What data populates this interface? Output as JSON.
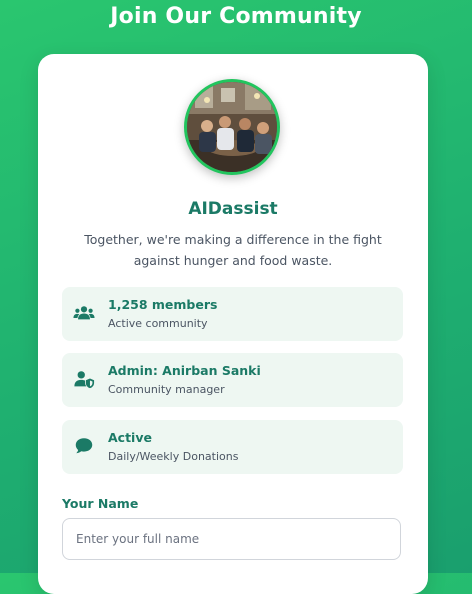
{
  "page": {
    "title": "Join Our Community"
  },
  "community": {
    "name": "AIDassist",
    "description": "Together, we're making a difference in the fight against hunger and food waste."
  },
  "info_items": [
    {
      "title": "1,258 members",
      "subtitle": "Active community",
      "icon": "users-icon"
    },
    {
      "title": "Admin: Anirban Sanki",
      "subtitle": "Community manager",
      "icon": "user-shield-icon"
    },
    {
      "title": "Active",
      "subtitle": "Daily/Weekly Donations",
      "icon": "comment-icon"
    }
  ],
  "form": {
    "name_label": "Your Name",
    "name_value": "",
    "name_placeholder": "Enter your full name"
  },
  "colors": {
    "background_gradient_start": "#2ac66f",
    "background_gradient_end": "#1a9f6e",
    "accent_text": "#1b7a66",
    "avatar_ring": "#22c55e",
    "info_box_bg": "#eef7f2",
    "icon": "#1b7a66"
  }
}
